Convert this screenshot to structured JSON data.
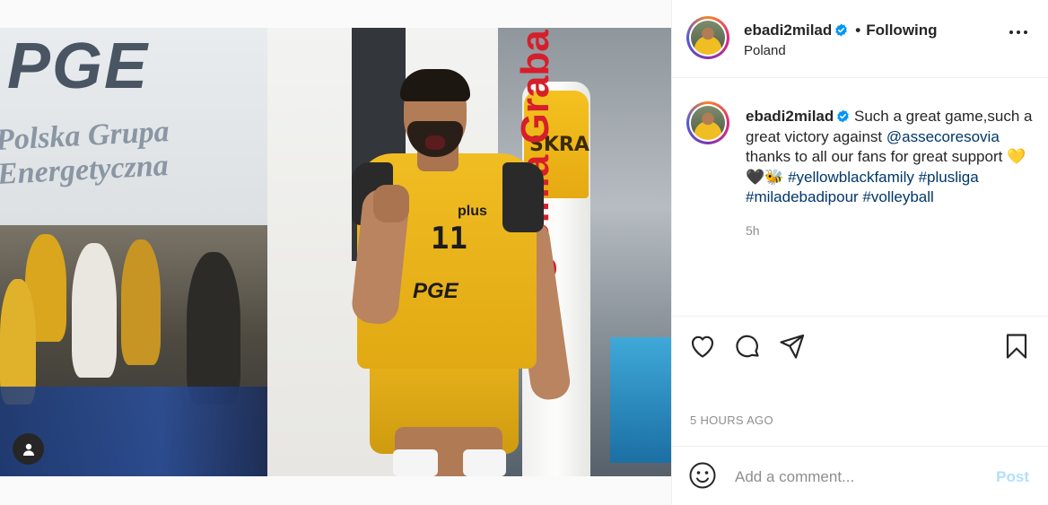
{
  "post": {
    "photo_alt": "Volleyball player celebrating in yellow PGE jersey",
    "photo_text": {
      "banner_brand": "PGE",
      "banner_sub_line1": "Polska Grupa",
      "banner_sub_line2": "Energetyczna",
      "jersey_number": "11",
      "jersey_brand": "PGE",
      "jersey_sponsor": "plus",
      "post_pad_text": "SKRA",
      "board_text": "cegielnia Grabarz"
    }
  },
  "header": {
    "username": "ebadi2milad",
    "separator": "•",
    "follow_status": "Following",
    "location": "Poland",
    "more_icon": "more-horizontal-icon"
  },
  "caption": {
    "username": "ebadi2milad",
    "text_1": "Such a great game,such a great victory against ",
    "mention": "@assecoresovia",
    "text_2": " thanks to all our fans for great support ",
    "emojis": "💛🖤🐝",
    "hashtags": "#yellowblackfamily #plusliga #miladebadipour #volleyball",
    "time_ago": "5h"
  },
  "actions": {
    "like_icon": "heart-icon",
    "comment_icon": "comment-icon",
    "share_icon": "send-icon",
    "save_icon": "bookmark-icon"
  },
  "timestamp": "5 HOURS AGO",
  "comment": {
    "placeholder": "Add a comment...",
    "post_label": "Post",
    "post_color": "#b2dffc"
  },
  "colors": {
    "verified": "#0095f6",
    "link": "#00376b",
    "muted": "#8e8e8e",
    "text": "#262626"
  }
}
